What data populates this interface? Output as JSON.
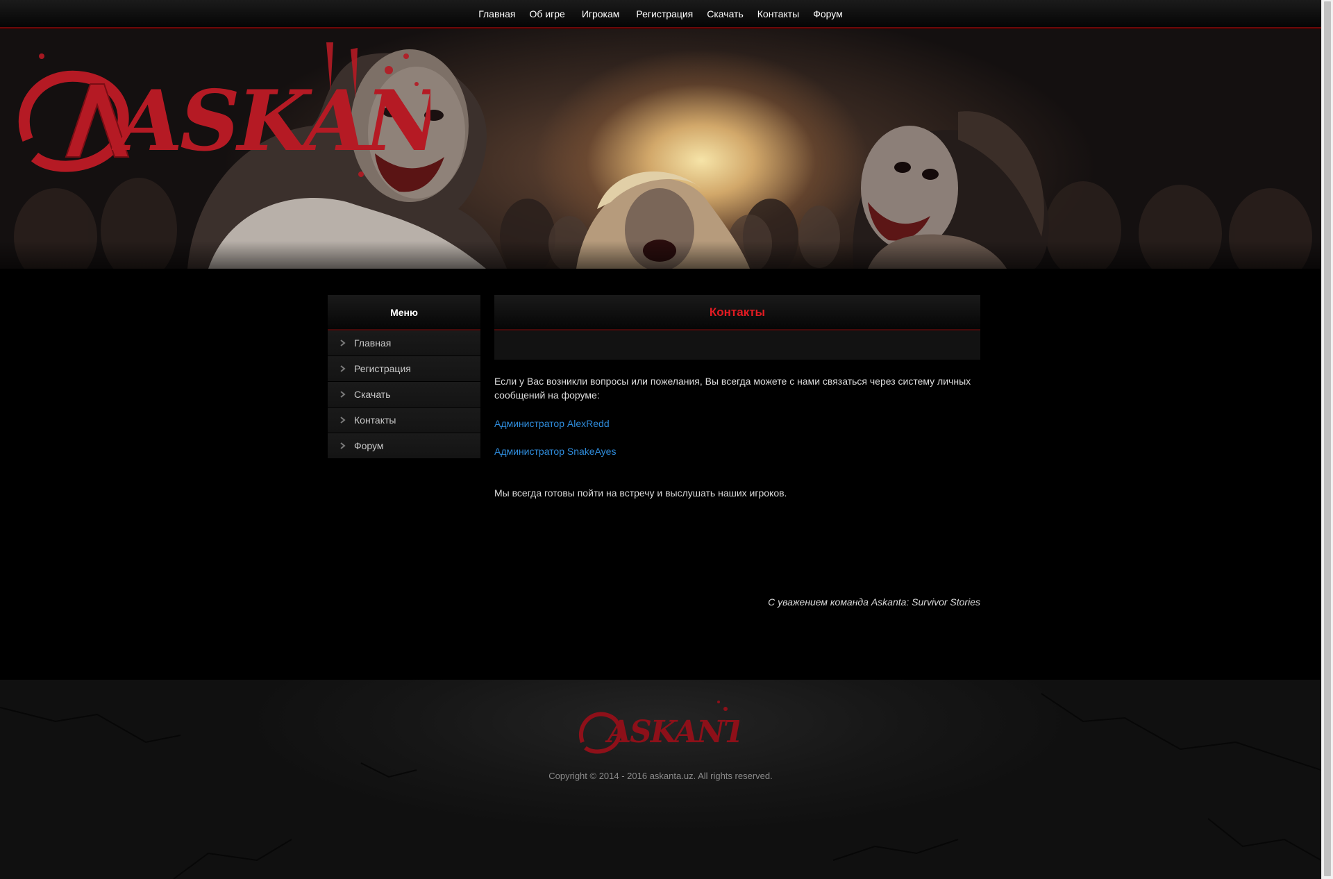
{
  "top_nav": {
    "items": [
      {
        "label": "Главная"
      },
      {
        "label": "Об игре"
      },
      {
        "label": "Игрокам"
      },
      {
        "label": "Регистрация"
      },
      {
        "label": "Скачать"
      },
      {
        "label": "Контакты"
      },
      {
        "label": "Форум"
      }
    ]
  },
  "banner": {
    "logo_text": "ASKANTA",
    "logo_color": "#b51a24"
  },
  "sidebar": {
    "title": "Меню",
    "items": [
      {
        "label": "Главная",
        "icon": "chevron-right-icon"
      },
      {
        "label": "Регистрация",
        "icon": "chevron-right-icon"
      },
      {
        "label": "Скачать",
        "icon": "chevron-right-icon"
      },
      {
        "label": "Контакты",
        "icon": "chevron-right-icon"
      },
      {
        "label": "Форум",
        "icon": "chevron-right-icon"
      }
    ]
  },
  "main": {
    "title": "Контакты",
    "title_color": "#e21b22",
    "intro": "Если у Вас возникли вопросы или пожелания, Вы всегда можете с нами связаться через систему личных сообщений на форуме:",
    "admins": [
      {
        "label": "Администратор AlexRedd"
      },
      {
        "label": "Администратор SnakeAyes"
      }
    ],
    "link_color": "#2f8ddd",
    "closing": "Мы всегда готовы пойти на встречу и выслушать наших игроков.",
    "signature": "С уважением команда Askanta: Survivor Stories"
  },
  "footer": {
    "logo_text": "ASKANTA",
    "copyright": "Copyright © 2014 - 2016 askanta.uz. All rights reserved."
  }
}
